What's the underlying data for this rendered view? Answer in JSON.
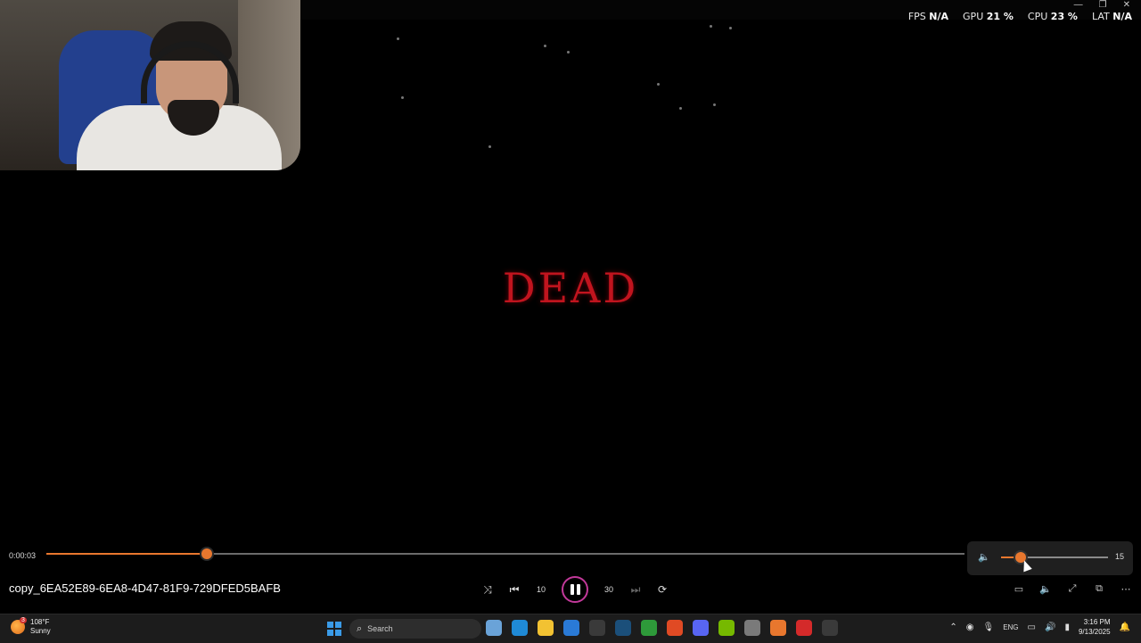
{
  "overlay": {
    "fps_label": "FPS",
    "fps_value": "N/A",
    "gpu_label": "GPU",
    "gpu_value": "21 %",
    "cpu_label": "CPU",
    "cpu_value": "23 %",
    "lat_label": "LAT",
    "lat_value": "N/A"
  },
  "window_controls": {
    "minimize": "—",
    "restore": "❐",
    "close": "✕"
  },
  "video": {
    "caption": "DEAD"
  },
  "player": {
    "elapsed": "0:00:03",
    "progress_fraction": 0.175,
    "file_name": "copy_6EA52E89-6EA8-4D47-81F9-729DFED5BAFB",
    "volume_value": "15",
    "volume_fraction": 0.18,
    "icons": {
      "shuffle": "shuffle-icon",
      "previous": "previous-icon",
      "rewind": "rewind-10-icon",
      "pause": "pause-icon",
      "forward": "forward-30-icon",
      "next": "next-icon",
      "repeat": "repeat-off-icon",
      "subtitles": "subtitles-icon",
      "volume": "volume-icon",
      "fullscreen": "fullscreen-icon",
      "miniplayer": "miniplayer-icon",
      "more": "more-icon"
    },
    "glyphs": {
      "shuffle": "⤨",
      "previous": "⏮",
      "rewind": "10",
      "forward": "30",
      "next": "⏭",
      "repeat": "⟳",
      "subtitles": "▭",
      "volume": "🔈",
      "fullscreen": "⤢",
      "miniplayer": "⧉",
      "more": "⋯"
    }
  },
  "taskbar": {
    "weather_badge": "3",
    "temperature": "108°F",
    "condition": "Sunny",
    "search_placeholder": "Search",
    "apps": [
      {
        "name": "widgets-app",
        "color": "#6aa3d8"
      },
      {
        "name": "edge-icon",
        "color": "#1f8ad6"
      },
      {
        "name": "file-explorer-icon",
        "color": "#f2c232"
      },
      {
        "name": "store-icon",
        "color": "#2a7ad6"
      },
      {
        "name": "terminal-icon",
        "color": "#3a3a3a"
      },
      {
        "name": "steam-icon",
        "color": "#1b4f7a"
      },
      {
        "name": "xbox-icon",
        "color": "#2e9a3a"
      },
      {
        "name": "brave-icon",
        "color": "#e04a24"
      },
      {
        "name": "discord-icon",
        "color": "#5865f2"
      },
      {
        "name": "nvidia-icon",
        "color": "#76b900"
      },
      {
        "name": "browser-icon",
        "color": "#7a7a7a"
      },
      {
        "name": "aimp-icon",
        "color": "#e8772e"
      },
      {
        "name": "media-app-icon",
        "color": "#d42a2a"
      },
      {
        "name": "media-player-icon",
        "color": "#3a3a3a"
      }
    ],
    "tray": {
      "language": "ENG",
      "time": "3:16 PM",
      "date": "9/13/2025"
    }
  }
}
